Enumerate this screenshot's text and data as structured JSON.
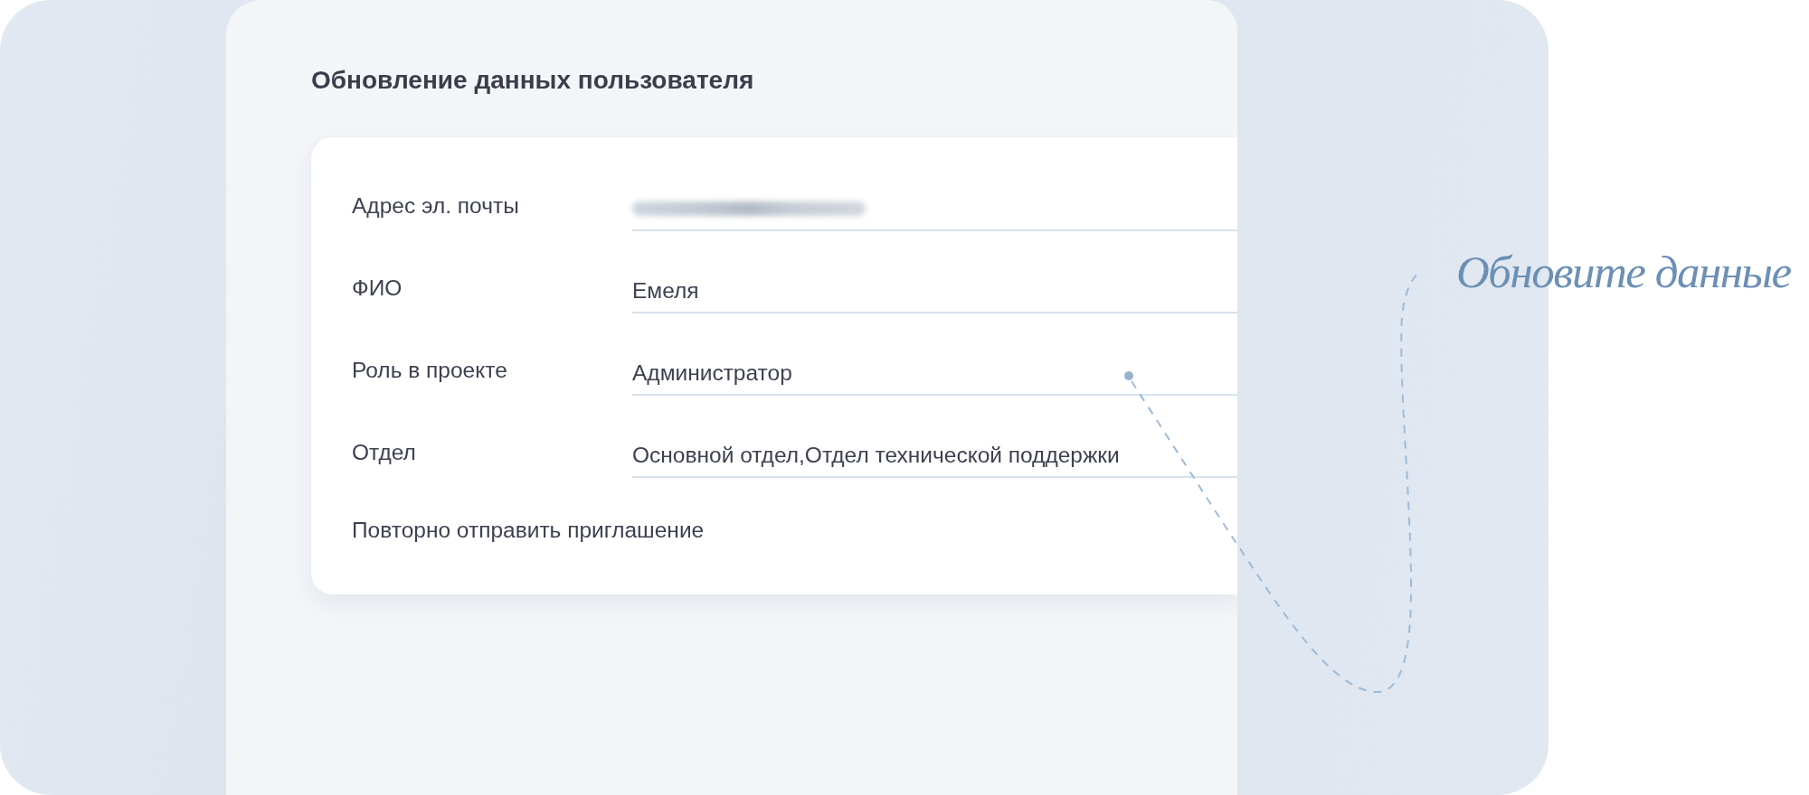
{
  "title": "Обновление данных пользователя",
  "form": {
    "rows": [
      {
        "kind": "field",
        "label": "Адрес эл. почты",
        "redacted": true
      },
      {
        "kind": "field",
        "label": "ФИО",
        "value": "Емеля"
      },
      {
        "kind": "field",
        "label": "Роль в проекте",
        "value": "Администратор"
      },
      {
        "kind": "field",
        "label": "Отдел",
        "value": "Основной отдел,Отдел технической поддержки"
      },
      {
        "kind": "action",
        "label": "Повторно отправить приглашение"
      }
    ]
  },
  "annotation": {
    "text": "Обновите данные"
  }
}
